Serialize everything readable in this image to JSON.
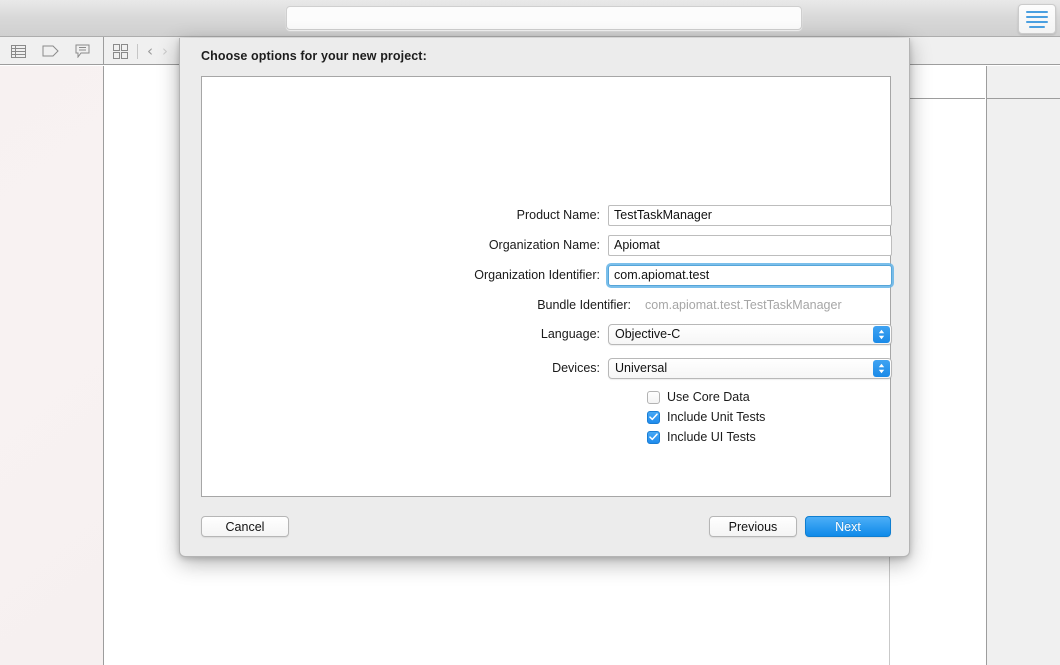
{
  "window": {
    "toolbar": {
      "jumpbar_value": "",
      "jumpbar_placeholder": "",
      "right_button_name": "editor-options-button"
    },
    "navigator_icons": [
      {
        "name": "list-view-icon",
        "label": "List View"
      },
      {
        "name": "tag-icon",
        "label": "Tag"
      },
      {
        "name": "comment-icon",
        "label": "Comment"
      }
    ],
    "nav_controls": [
      {
        "name": "grid-view-icon",
        "label": "Grid View"
      },
      {
        "name": "back-chevron-icon",
        "label": "Back",
        "disabled": false
      },
      {
        "name": "forward-chevron-icon",
        "label": "Forward",
        "disabled": true
      }
    ]
  },
  "sheet": {
    "title": "Choose options for your new project:",
    "fields": [
      {
        "id": "product-name",
        "label": "Product Name:",
        "value": "TestTaskManager",
        "type": "text",
        "focused": false
      },
      {
        "id": "organization-name",
        "label": "Organization Name:",
        "value": "Apiomat",
        "type": "text",
        "focused": false
      },
      {
        "id": "organization-identifier",
        "label": "Organization Identifier:",
        "value": "com.apiomat.test",
        "type": "text",
        "focused": true
      },
      {
        "id": "bundle-identifier",
        "label": "Bundle Identifier:",
        "value": "com.apiomat.test.TestTaskManager",
        "type": "static",
        "focused": false
      },
      {
        "id": "language",
        "label": "Language:",
        "value": "Objective-C",
        "type": "popup",
        "focused": false
      },
      {
        "id": "devices",
        "label": "Devices:",
        "value": "Universal",
        "type": "popup",
        "focused": false
      }
    ],
    "checkboxes": [
      {
        "id": "use-core-data",
        "label": "Use Core Data",
        "checked": false
      },
      {
        "id": "include-unit-tests",
        "label": "Include Unit Tests",
        "checked": true
      },
      {
        "id": "include-ui-tests",
        "label": "Include UI Tests",
        "checked": true
      }
    ],
    "buttons": {
      "cancel": "Cancel",
      "previous": "Previous",
      "next": "Next"
    }
  },
  "colors": {
    "accent_blue": "#1a8ae8",
    "focus_ring": "#64b4e8",
    "sheet_bg": "#ececec",
    "chrome_gray": "#d8d8d8",
    "icon_gray": "#8a8a8a",
    "disabled_text": "#a6a6a6"
  }
}
